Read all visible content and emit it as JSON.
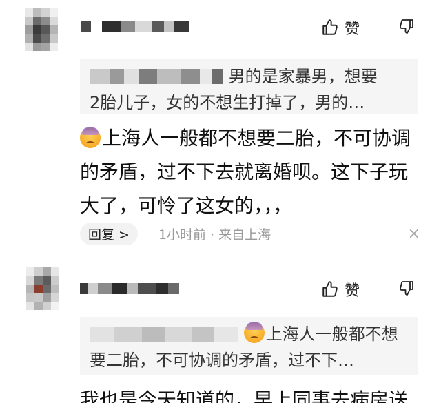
{
  "comments": [
    {
      "like_label": "赞",
      "quote_line1": "男的是家暴男，想要",
      "quote_line2": "2胎儿子，女的不想生打掉了，男的…",
      "body_line1": "上海人一般都不想要二胎，不可协调",
      "body_line2": "的矛盾，过不下去就离婚呗。这下子玩",
      "body_line3": "大了，可怜了这女的，，，",
      "reply_label": "回复 >",
      "meta": "1小时前 · 来自上海",
      "close": "×"
    },
    {
      "like_label": "赞",
      "quote_line1": "上海人一般都不想",
      "quote_line2": "要二胎，不可协调的矛盾，过不下…",
      "body_line1": "我也是今天知道的，早上同事去病房送"
    }
  ],
  "icons": {
    "like": "thumb-up-icon",
    "dislike": "thumb-down-icon",
    "emoji": "sweat-face-emoji"
  }
}
